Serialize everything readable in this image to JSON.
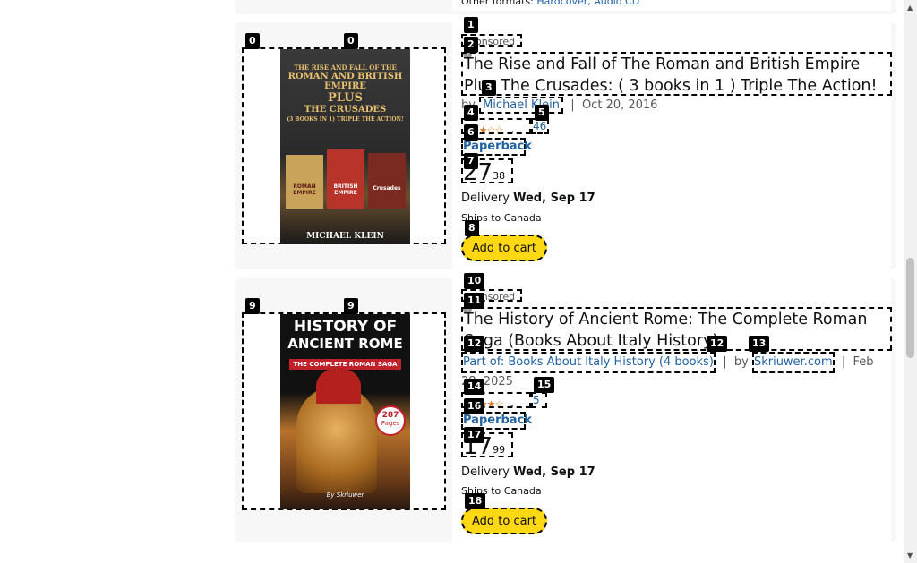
{
  "top_partial": {
    "other_formats_label": "Other formats:",
    "other_formats_links": "Hardcover, Audio CD"
  },
  "products": [
    {
      "sponsored": "Sponsored",
      "title": "The Rise and Fall of The Roman and British Empire Plus The Crusades: ( 3 books in 1 ) Triple The Action!",
      "by": "by",
      "author": "Michael Klein",
      "date": "Oct 20, 2016",
      "rating_count": "46",
      "format": "Paperback",
      "price_whole": "27",
      "price_fraction": "38",
      "delivery_label": "Delivery",
      "delivery_date": "Wed, Sep 17",
      "ships": "Ships to Canada",
      "cart_label": "Add to cart",
      "cover": {
        "line1": "THE RISE AND FALL OF THE",
        "line2": "ROMAN AND BRITISH",
        "line3": "EMPIRE",
        "line4": "PLUS",
        "line5": "THE CRUSADES",
        "line6": "(3 BOOKS IN 1) TRIPLE THE ACTION!",
        "mini1": "ROMAN EMPIRE",
        "mini2": "BRITISH EMPIRE",
        "mini3": "Crusades",
        "author": "MICHAEL KLEIN"
      }
    },
    {
      "sponsored": "Sponsored",
      "title": "The History of Ancient Rome: The Complete Roman Saga (Books About Italy History)",
      "series": "Part of: Books About Italy History (4 books)",
      "by": "by",
      "author": "Skriuwer.com",
      "date": "Feb 28, 2025",
      "rating_count": "5",
      "format": "Paperback",
      "price_whole": "17",
      "price_fraction": "99",
      "delivery_label": "Delivery",
      "delivery_date": "Wed, Sep 17",
      "ships": "Ships to Canada",
      "cart_label": "Add to cart",
      "cover": {
        "line1": "HISTORY OF",
        "line2": "ANCIENT ROME",
        "line3": "THE COMPLETE ROMAN SAGA",
        "badge_num": "287",
        "badge_text": "Pages",
        "author": "By Skriuwer"
      }
    }
  ],
  "markers": [
    "0",
    "1",
    "2",
    "3",
    "4",
    "5",
    "6",
    "7",
    "8",
    "9",
    "10",
    "11",
    "12",
    "13",
    "14",
    "15",
    "16",
    "17",
    "18"
  ],
  "colors": {
    "accent_link": "#2162a1",
    "cart_button": "#ffd814",
    "star": "#de7921",
    "card_bg": "#f7f7f7"
  }
}
